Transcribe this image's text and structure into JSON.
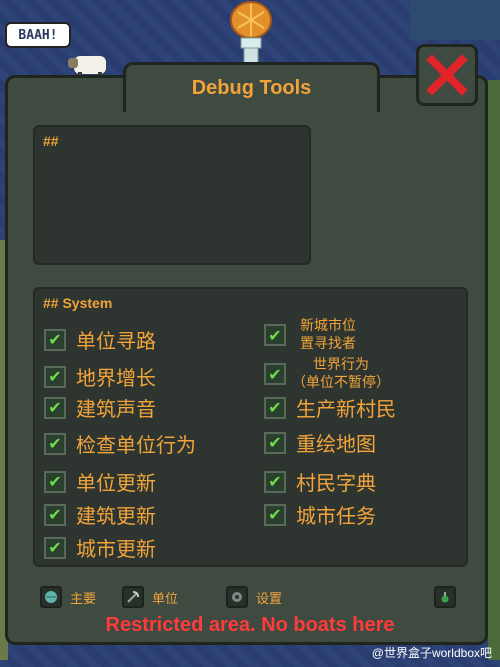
{
  "speech_bubble": "BAAH!",
  "window": {
    "title": "Debug Tools",
    "close_icon": "close-x-icon"
  },
  "top_box": {
    "header": "##"
  },
  "system_box": {
    "header": "## System",
    "left_options": [
      {
        "label": "单位寻路",
        "checked": true
      },
      {
        "label": "地界增长",
        "checked": true
      },
      {
        "label": "建筑声音",
        "checked": true
      },
      {
        "label": "检查单位行为",
        "checked": true
      },
      {
        "label": "单位更新",
        "checked": true
      },
      {
        "label": "建筑更新",
        "checked": true
      },
      {
        "label": "城市更新",
        "checked": true
      }
    ],
    "right_options": [
      {
        "line1": "新城市位",
        "line2": "置寻找者",
        "checked": true
      },
      {
        "line1": "世界行为",
        "line2": "（单位不暂停）",
        "checked": true
      },
      {
        "label": "生产新村民",
        "checked": true
      },
      {
        "label": "重绘地图",
        "checked": true
      },
      {
        "label": "村民字典",
        "checked": true
      },
      {
        "label": "城市任务",
        "checked": true
      }
    ]
  },
  "bottom_tabs": [
    {
      "label": "主要",
      "icon": "globe-icon"
    },
    {
      "label": "单位",
      "icon": "pickaxe-icon"
    },
    {
      "label": "设置",
      "icon": "gear-icon"
    },
    {
      "label": "",
      "icon": "potion-icon"
    }
  ],
  "status_message": "Restricted area. No boats here",
  "watermark": "@世界盒子worldbox吧",
  "colors": {
    "accent": "#f2a43a",
    "panel": "#3f4a40",
    "check": "#6fdc4a",
    "warning": "#ff3b3b",
    "ocean": "#2a3f74"
  }
}
